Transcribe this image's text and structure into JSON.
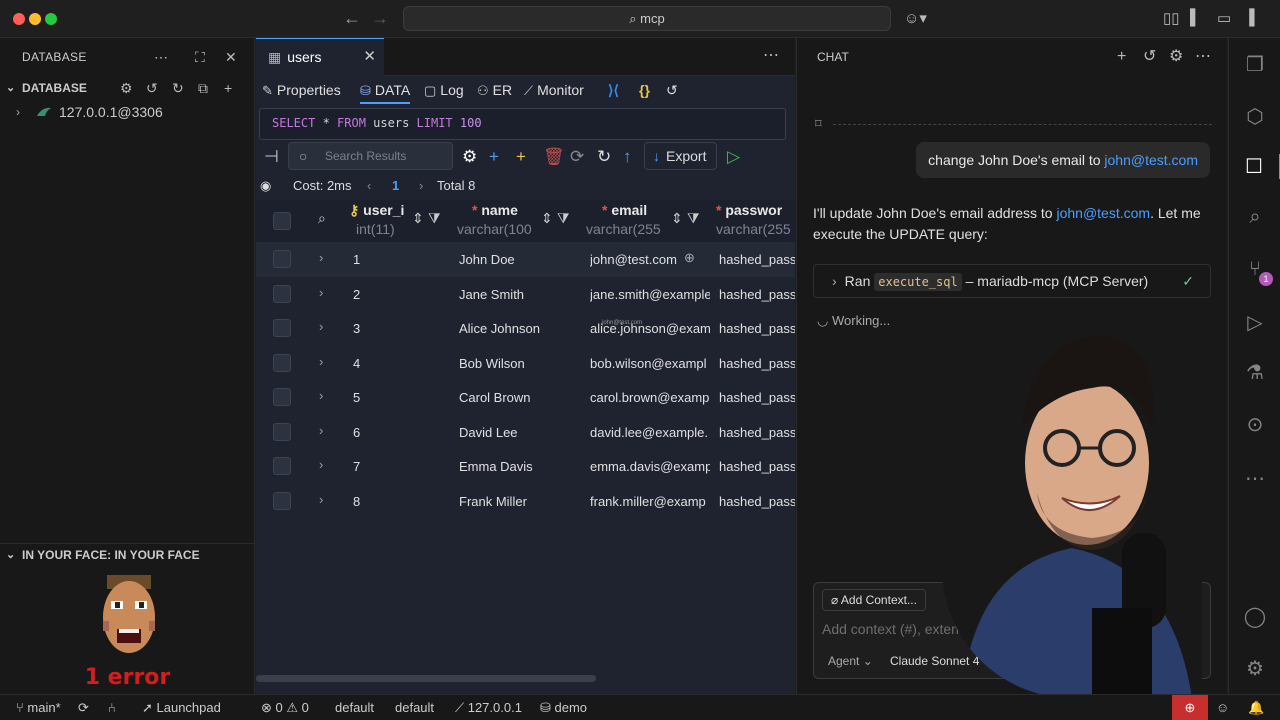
{
  "titlebar": {
    "search": "mcp"
  },
  "left": {
    "header": "DATABASE",
    "section": "DATABASE",
    "connection": "127.0.0.1@3306",
    "face_header": "IN YOUR FACE: IN YOUR FACE",
    "error_text": "1 error"
  },
  "editor": {
    "tab": "users",
    "subtabs": {
      "properties": "Properties",
      "data": "DATA",
      "log": "Log",
      "er": "ER",
      "monitor": "Monitor"
    },
    "sql": {
      "select": "SELECT",
      "star": " * ",
      "from": "FROM",
      "table": " users ",
      "limit": "LIMIT",
      "limit_value": " 100"
    },
    "search_placeholder": "Search Results",
    "export": "Export",
    "cost": "Cost: 2ms",
    "page": "1",
    "total": "Total 8",
    "columns": [
      {
        "name": "user_i",
        "type": "int(11)"
      },
      {
        "name": "name",
        "type": "varchar(100"
      },
      {
        "name": "email",
        "type": "varchar(255"
      },
      {
        "name": "passwor",
        "type": "varchar(255"
      }
    ],
    "rows": [
      {
        "id": "1",
        "name": "John Doe",
        "email": "john@test.com",
        "password": "hashed_pass"
      },
      {
        "id": "2",
        "name": "Jane Smith",
        "email": "jane.smith@example",
        "password": "hashed_pass"
      },
      {
        "id": "3",
        "name": "Alice Johnson",
        "email": "alice.johnson@exam",
        "password": "hashed_pass"
      },
      {
        "id": "4",
        "name": "Bob Wilson",
        "email": "bob.wilson@exampl",
        "password": "hashed_pass"
      },
      {
        "id": "5",
        "name": "Carol Brown",
        "email": "carol.brown@examp",
        "password": "hashed_pass"
      },
      {
        "id": "6",
        "name": "David Lee",
        "email": "david.lee@example.",
        "password": "hashed_pass"
      },
      {
        "id": "7",
        "name": "Emma Davis",
        "email": "emma.davis@examp",
        "password": "hashed_pass"
      },
      {
        "id": "8",
        "name": "Frank Miller",
        "email": "frank.miller@examp",
        "password": "hashed_pass"
      }
    ],
    "tooltip": "john@test.com"
  },
  "chat": {
    "header": "CHAT",
    "user_msg_prefix": "change John Doe's email to ",
    "user_msg_link": "john@test.com",
    "reply_a": "I'll update John Doe's email address to ",
    "reply_link": "john@test.com",
    "reply_b": ". Let me execute the UPDATE query:",
    "tool_ran": "Ran",
    "tool_name": "execute_sql",
    "tool_server": "– mariadb-mcp (MCP Server)",
    "working": "Working...",
    "add_context": "Add Context...",
    "input_placeholder": "Add context (#), extens",
    "agent": "Agent",
    "model": "Claude Sonnet 4"
  },
  "activity": {
    "scm_badge": "1"
  },
  "status": {
    "branch": "main*",
    "launchpad": "Launchpad",
    "errors": "0",
    "warnings": "0",
    "profile1": "default",
    "profile2": "default",
    "host": "127.0.0.1",
    "db": "demo"
  }
}
